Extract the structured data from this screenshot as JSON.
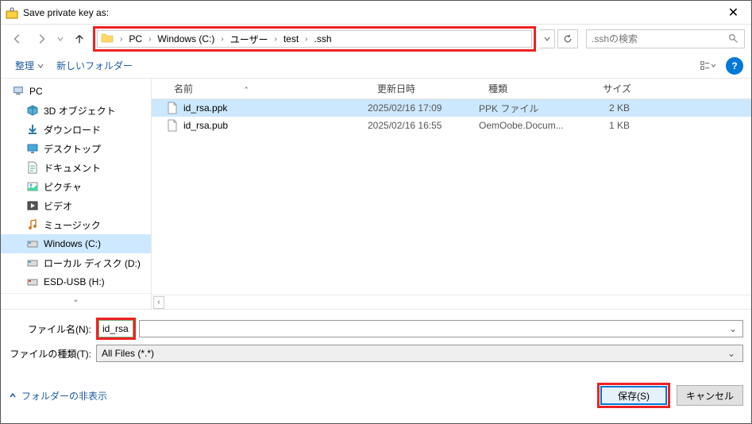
{
  "window": {
    "title": "Save private key as:"
  },
  "breadcrumb": {
    "segments": [
      "PC",
      "Windows (C:)",
      "ユーザー",
      "test",
      ".ssh"
    ]
  },
  "search": {
    "placeholder": ".sshの検索"
  },
  "toolbar": {
    "organize": "整理",
    "newfolder": "新しいフォルダー"
  },
  "columns": {
    "name": "名前",
    "date": "更新日時",
    "type": "種類",
    "size": "サイズ"
  },
  "tree": [
    {
      "label": "PC",
      "icon": "pc",
      "child": false
    },
    {
      "label": "3D オブジェクト",
      "icon": "3d",
      "child": true
    },
    {
      "label": "ダウンロード",
      "icon": "dl",
      "child": true
    },
    {
      "label": "デスクトップ",
      "icon": "desk",
      "child": true
    },
    {
      "label": "ドキュメント",
      "icon": "doc",
      "child": true
    },
    {
      "label": "ピクチャ",
      "icon": "pic",
      "child": true
    },
    {
      "label": "ビデオ",
      "icon": "vid",
      "child": true
    },
    {
      "label": "ミュージック",
      "icon": "mus",
      "child": true
    },
    {
      "label": "Windows (C:)",
      "icon": "drive",
      "child": true,
      "sel": true
    },
    {
      "label": "ローカル ディスク (D:)",
      "icon": "drive",
      "child": true
    },
    {
      "label": "ESD-USB (H:)",
      "icon": "usb",
      "child": true
    }
  ],
  "files": [
    {
      "name": "id_rsa.ppk",
      "date": "2025/02/16 17:09",
      "type": "PPK ファイル",
      "size": "2 KB",
      "sel": true
    },
    {
      "name": "id_rsa.pub",
      "date": "2025/02/16 16:55",
      "type": "OemOobe.Docum...",
      "size": "1 KB",
      "sel": false
    }
  ],
  "filename": {
    "label": "ファイル名(N):",
    "value": "id_rsa"
  },
  "filetype": {
    "label": "ファイルの種類(T):",
    "value": "All Files (*.*)"
  },
  "footer": {
    "hide": "フォルダーの非表示",
    "save": "保存(S)",
    "cancel": "キャンセル"
  }
}
